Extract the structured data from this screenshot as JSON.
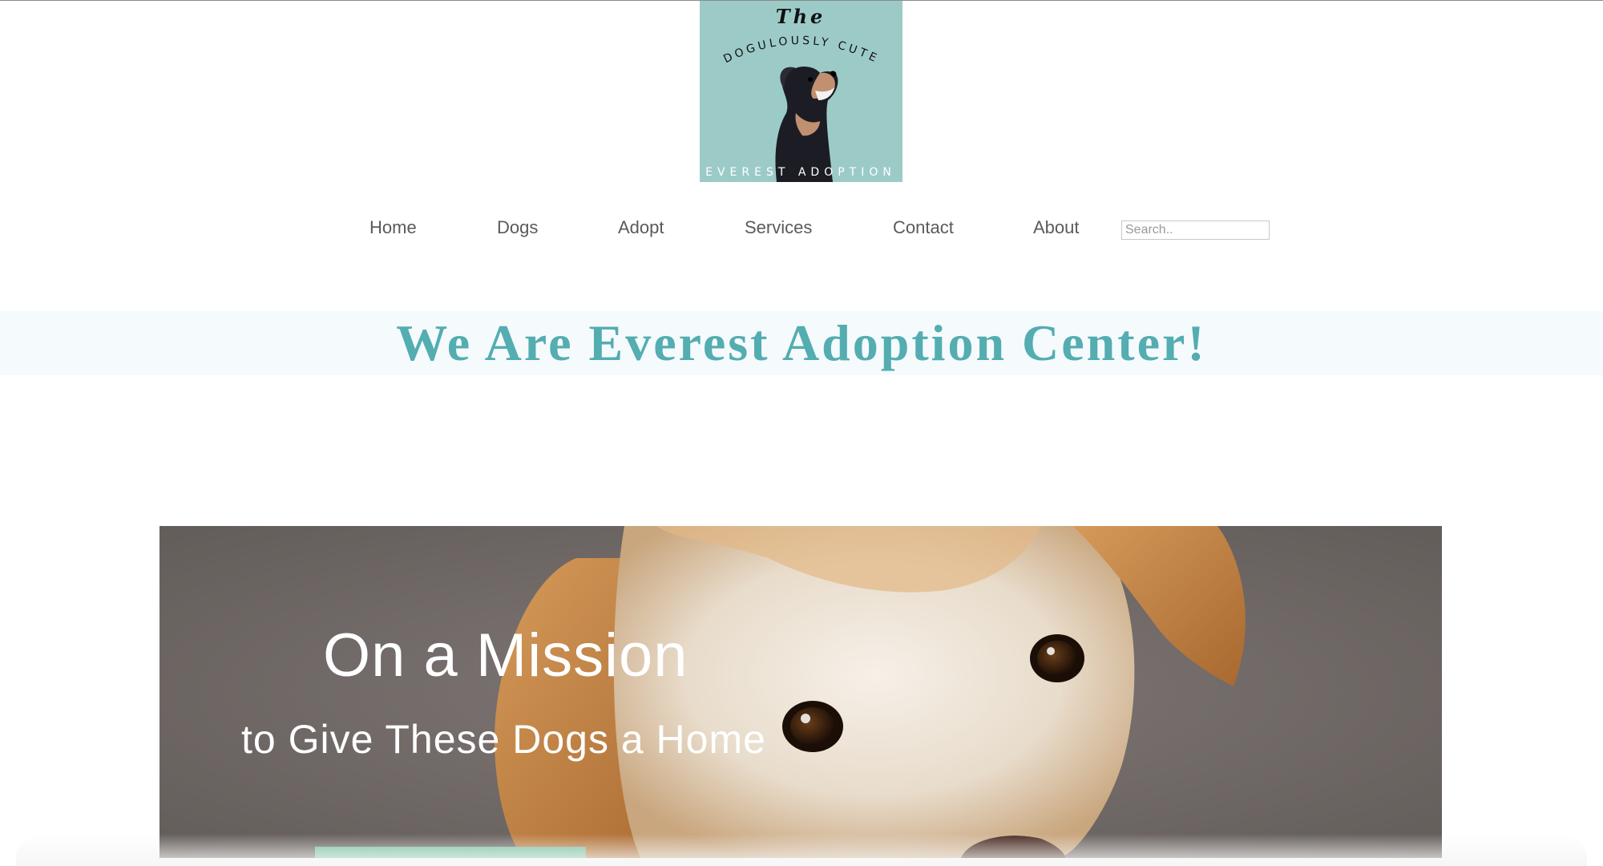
{
  "logo": {
    "line_top": "The",
    "line_arc": "DOGULOUSLY CUTE",
    "line_bottom": "EVEREST ADOPTION",
    "icon": "rottweiler-dog-illustration",
    "background_color": "#9ccbc7"
  },
  "nav": {
    "items": [
      {
        "label": "Home"
      },
      {
        "label": "Dogs"
      },
      {
        "label": "Adopt"
      },
      {
        "label": "Services"
      },
      {
        "label": "Contact"
      },
      {
        "label": "About"
      }
    ],
    "search_placeholder": "Search.."
  },
  "banner": {
    "title": "We Are Everest Adoption Center!",
    "color": "#53adb1"
  },
  "hero": {
    "title": "On a Mission",
    "subtitle": "to Give These Dogs a Home",
    "image": "beagle-dog-photo",
    "cta_color": "#77c0a0"
  }
}
